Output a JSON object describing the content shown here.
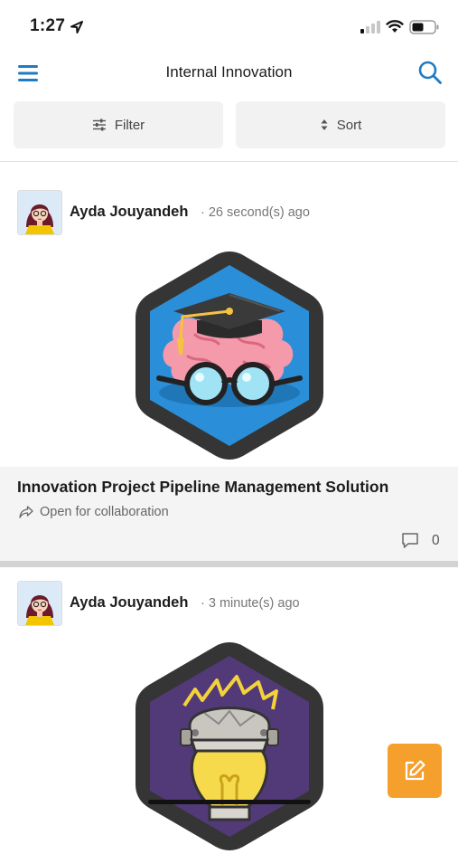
{
  "status_bar": {
    "time": "1:27",
    "icons": [
      "location-arrow-icon",
      "cellular-signal-icon",
      "wifi-icon",
      "battery-icon"
    ]
  },
  "header": {
    "title": "Internal Innovation",
    "menu_icon": "hamburger-menu-icon",
    "search_icon": "search-icon",
    "accent_color": "#1f7bc4"
  },
  "toolbar": {
    "filter_label": "Filter",
    "sort_label": "Sort"
  },
  "posts": [
    {
      "author": "Ayda Jouyandeh",
      "time": "· 26 second(s) ago",
      "badge_icon": "brain-graduation-cap-icon",
      "title": "Innovation Project Pipeline Management Solution",
      "status": "Open for collaboration",
      "comment_count": "0"
    },
    {
      "author": "Ayda Jouyandeh",
      "time": "· 3 minute(s) ago",
      "badge_icon": "lightbulb-robot-icon"
    }
  ],
  "fab": {
    "icon": "compose-icon",
    "color": "#f5a02c"
  }
}
